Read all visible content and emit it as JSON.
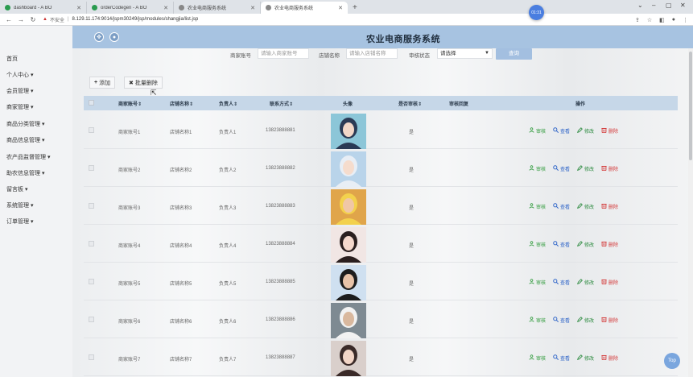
{
  "browser": {
    "tabs": [
      {
        "title": "dashboard - A BO",
        "color": "#2a9b4f"
      },
      {
        "title": "orderCodegen - A BO",
        "color": "#2a9b4f"
      },
      {
        "title": "农业电商服务系统",
        "color": "#666666"
      },
      {
        "title": "农业电商服务系统",
        "color": "#666666"
      }
    ],
    "timer": "01:31",
    "url_insecure": "不安全",
    "url": "8.129.11.174:9014/jspm30249/jsp/modules/shangjia/list.jsp"
  },
  "app": {
    "title": "农业电商服务系统"
  },
  "sidebar": {
    "items": [
      "首页",
      "个人中心 ▾",
      "会员管理 ▾",
      "商家管理 ▾",
      "商品分类管理 ▾",
      "商品信息管理 ▾",
      "农产品监督管理 ▾",
      "助农信息管理 ▾",
      "留言板 ▾",
      "系统管理 ▾",
      "订单管理 ▾"
    ]
  },
  "search": {
    "account_label": "商家账号",
    "account_placeholder": "请输入商家账号",
    "shop_label": "店铺名称",
    "shop_placeholder": "请输入店铺名称",
    "status_label": "审核状态",
    "status_value": "请选择",
    "search_button": "查询"
  },
  "actions": {
    "add": "添加",
    "batch_delete": "批量删除"
  },
  "table": {
    "headers": [
      "商家账号",
      "店铺名称",
      "负责人",
      "联系方式",
      "头像",
      "是否审核",
      "审核回复",
      "操作"
    ],
    "rows": [
      {
        "account": "商家账号1",
        "shop": "店铺名称1",
        "owner": "负责人1",
        "phone": "13823888881",
        "audited": "是",
        "reply": ""
      },
      {
        "account": "商家账号2",
        "shop": "店铺名称2",
        "owner": "负责人2",
        "phone": "13823888882",
        "audited": "是",
        "reply": ""
      },
      {
        "account": "商家账号3",
        "shop": "店铺名称3",
        "owner": "负责人3",
        "phone": "13823888883",
        "audited": "是",
        "reply": ""
      },
      {
        "account": "商家账号4",
        "shop": "店铺名称4",
        "owner": "负责人4",
        "phone": "13823888884",
        "audited": "是",
        "reply": ""
      },
      {
        "account": "商家账号5",
        "shop": "店铺名称5",
        "owner": "负责人5",
        "phone": "13823888885",
        "audited": "是",
        "reply": ""
      },
      {
        "account": "商家账号6",
        "shop": "店铺名称6",
        "owner": "负责人6",
        "phone": "13823888886",
        "audited": "是",
        "reply": ""
      },
      {
        "account": "商家账号7",
        "shop": "店铺名称7",
        "owner": "负责人7",
        "phone": "13823888887",
        "audited": "是",
        "reply": ""
      }
    ],
    "ops": {
      "audit": "审核",
      "view": "查看",
      "edit": "修改",
      "delete": "删除"
    }
  },
  "top_button": "Top",
  "colors": {
    "header": "#a7c3e1",
    "accent": "#a3bfe0",
    "delete": "#d43c3c",
    "audit": "#2e9a3a"
  }
}
